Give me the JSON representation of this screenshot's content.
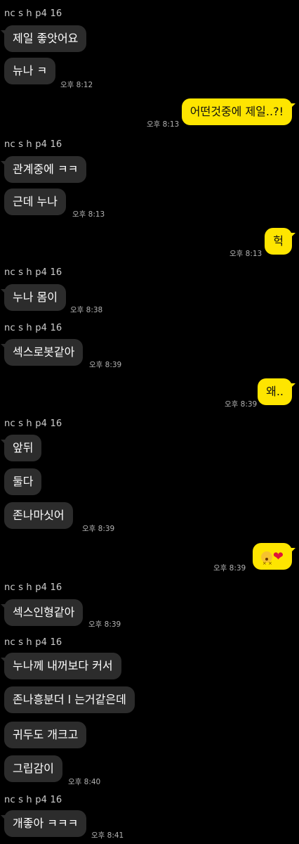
{
  "messages": [
    {
      "name": "nc s h p4 16"
    },
    {
      "text": "제일 좋앗어요"
    },
    {
      "text": "뉴나 ㅋ",
      "time": "오후 8:12"
    },
    {
      "text": "어떤것중에 제일..?!",
      "time": "오후 8:13"
    },
    {
      "name": "nc s h p4 16"
    },
    {
      "text": "관계중에 ㅋㅋ"
    },
    {
      "text": "근데 누나",
      "time": "오후 8:13"
    },
    {
      "text": "헉",
      "time": "오후 8:13"
    },
    {
      "name": "nc s h p4 16"
    },
    {
      "text": "누나 몸이",
      "time": "오후 8:38"
    },
    {
      "name": "nc s h p4 16"
    },
    {
      "text": "섹스로봇같아",
      "time": "오후 8:39"
    },
    {
      "text": "왜..",
      "time": "오후 8:39"
    },
    {
      "name": "nc s h p4 16"
    },
    {
      "text": "앞뒤"
    },
    {
      "text": "둘다"
    },
    {
      "text": "존나마싯어",
      "time": "오후 8:39"
    },
    {
      "emojis": [
        "dizzy-face",
        "red-heart"
      ],
      "time": "오후 8:39"
    },
    {
      "name": "nc s h p4 16"
    },
    {
      "text": "섹스인형같아",
      "time": "오후 8:39"
    },
    {
      "name": "nc s h p4 16"
    },
    {
      "text": "누나께 내꺼보다 커서"
    },
    {
      "text": "존나흥분더 l 는거같은데"
    },
    {
      "text": "귀두도 개크고"
    },
    {
      "text": "그립감이",
      "time": "오후 8:40"
    },
    {
      "name": "nc s h p4 16"
    },
    {
      "text": "개좋아 ㅋㅋㅋ",
      "time": "오후 8:41"
    }
  ]
}
